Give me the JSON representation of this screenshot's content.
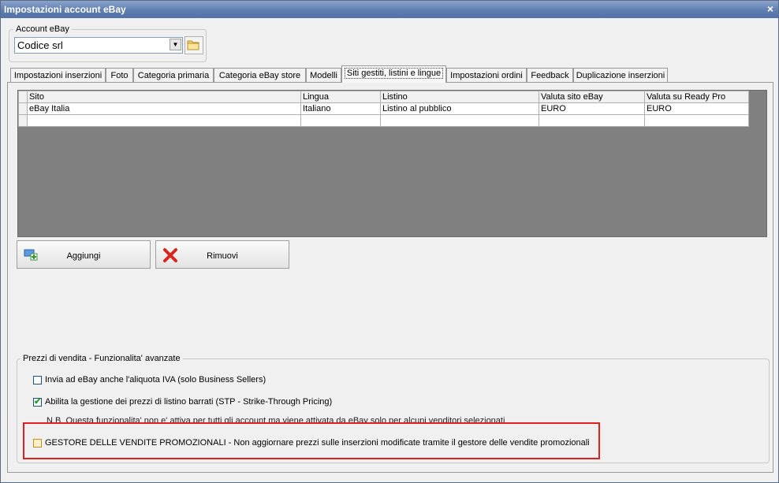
{
  "window": {
    "title": "Impostazioni account eBay",
    "close": "×"
  },
  "account": {
    "group_label": "Account eBay",
    "value": "Codice srl"
  },
  "tabs": [
    {
      "label": "Impostazioni inserzioni"
    },
    {
      "label": "Foto"
    },
    {
      "label": "Categoria primaria"
    },
    {
      "label": "Categoria eBay store"
    },
    {
      "label": "Modelli"
    },
    {
      "label": "Siti gestiti, listini e lingue",
      "active": true
    },
    {
      "label": "Impostazioni ordini"
    },
    {
      "label": "Feedback"
    },
    {
      "label": "Duplicazione inserzioni"
    }
  ],
  "table": {
    "columns": [
      "Sito",
      "Lingua",
      "Listino",
      "Valuta sito eBay",
      "Valuta su Ready Pro"
    ],
    "rows": [
      [
        "eBay Italia",
        "Italiano",
        "Listino al pubblico",
        "EURO",
        "EURO"
      ],
      [
        "",
        "",
        "",
        "",
        ""
      ]
    ]
  },
  "buttons": {
    "add": "Aggiungi",
    "remove": "Rimuovi"
  },
  "advanced": {
    "group_label": "Prezzi di vendita - Funzionalita' avanzate",
    "vat_label": "Invia ad eBay anche l'aliquota IVA (solo Business Sellers)",
    "vat_checked": false,
    "stp_label": "Abilita la gestione dei prezzi di listino barrati (STP - Strike-Through Pricing)",
    "stp_checked": true,
    "note": "N.B. Questa funzionalita' non e' attiva per tutti gli account ma viene attivata da eBay solo per alcuni venditori selezionati",
    "promo_label": "GESTORE DELLE VENDITE PROMOZIONALI - Non aggiornare prezzi sulle inserzioni modificate tramite il gestore delle vendite promozionali",
    "promo_checked": false
  },
  "colors": {
    "highlight": "#e02020",
    "titlebar": "#5f7eb0",
    "grid_background": "#808080"
  }
}
